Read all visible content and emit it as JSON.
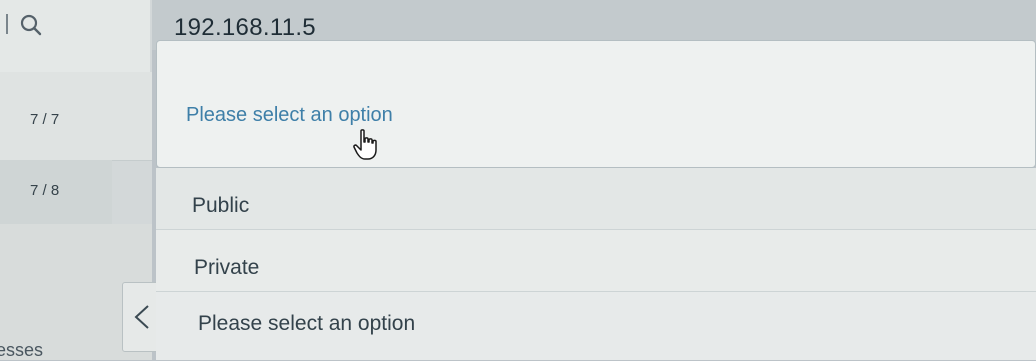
{
  "address_bar": {
    "value": "192.168.11.5"
  },
  "sidebar": {
    "counters": [
      "7 / 7",
      "7 / 8"
    ],
    "partial_label": "esses"
  },
  "select": {
    "current_value": "Please select an option",
    "options": [
      "Public",
      "Private",
      "Please select an option"
    ]
  },
  "colors": {
    "accent": "#3e7fa8",
    "background": "#bcc3c8",
    "panel": "#e3e7e6"
  },
  "icons": [
    "search-icon",
    "hand-pointer-cursor",
    "chevron-left-icon"
  ]
}
